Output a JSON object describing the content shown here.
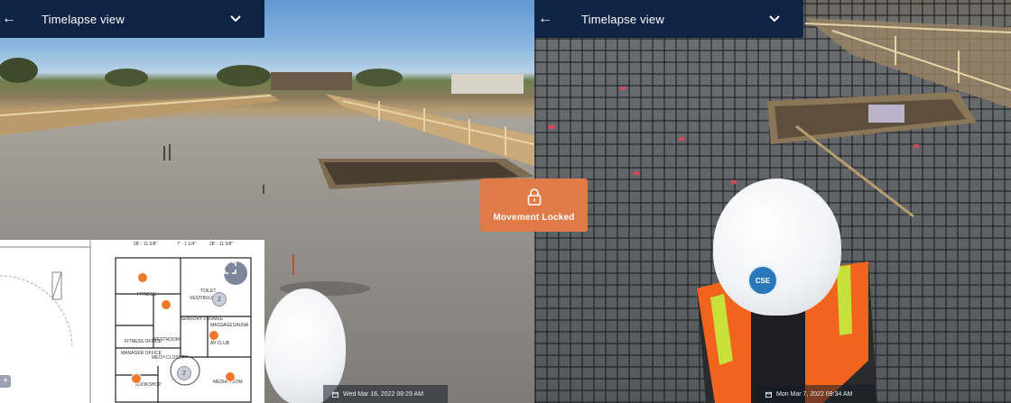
{
  "left_view": {
    "toolbar": {
      "title": "Timelapse view",
      "back_icon": "arrow-left-icon",
      "menu_icon": "chevron-down-icon"
    },
    "date": "Wed Mar 16, 2022 08:29 AM",
    "floorplan": {
      "dimensions": [
        "28' - 11 5/8\"",
        "7' - 1 1/4\"",
        "28' - 11 5/8\""
      ],
      "rooms": [
        "FITNESS",
        "FITNESS OFFICE",
        "MANAGER OFFICE",
        "RESTROOM",
        "VESTIBULE",
        "SENSORY LOUNGE",
        "TOILET",
        "MASSAGE",
        "SAUNA",
        "AV CLUB",
        "MECH CLOSET",
        "MEDIA ROOM",
        "BOOKSHOP"
      ],
      "markers": [
        "2",
        "2"
      ],
      "zoom_label": "+"
    }
  },
  "right_view": {
    "toolbar": {
      "title": "Timelapse view",
      "back_icon": "arrow-left-icon",
      "menu_icon": "chevron-down-icon"
    },
    "date": "Mon Mar 7, 2022 09:34 AM",
    "helmet_logo": "CSE"
  },
  "lock_overlay": {
    "label": "Movement Locked",
    "icon": "lock-icon"
  },
  "colors": {
    "toolbar_bg": "#0f2344",
    "lock_bg": "#e07a47",
    "pin": "#f0772e"
  }
}
